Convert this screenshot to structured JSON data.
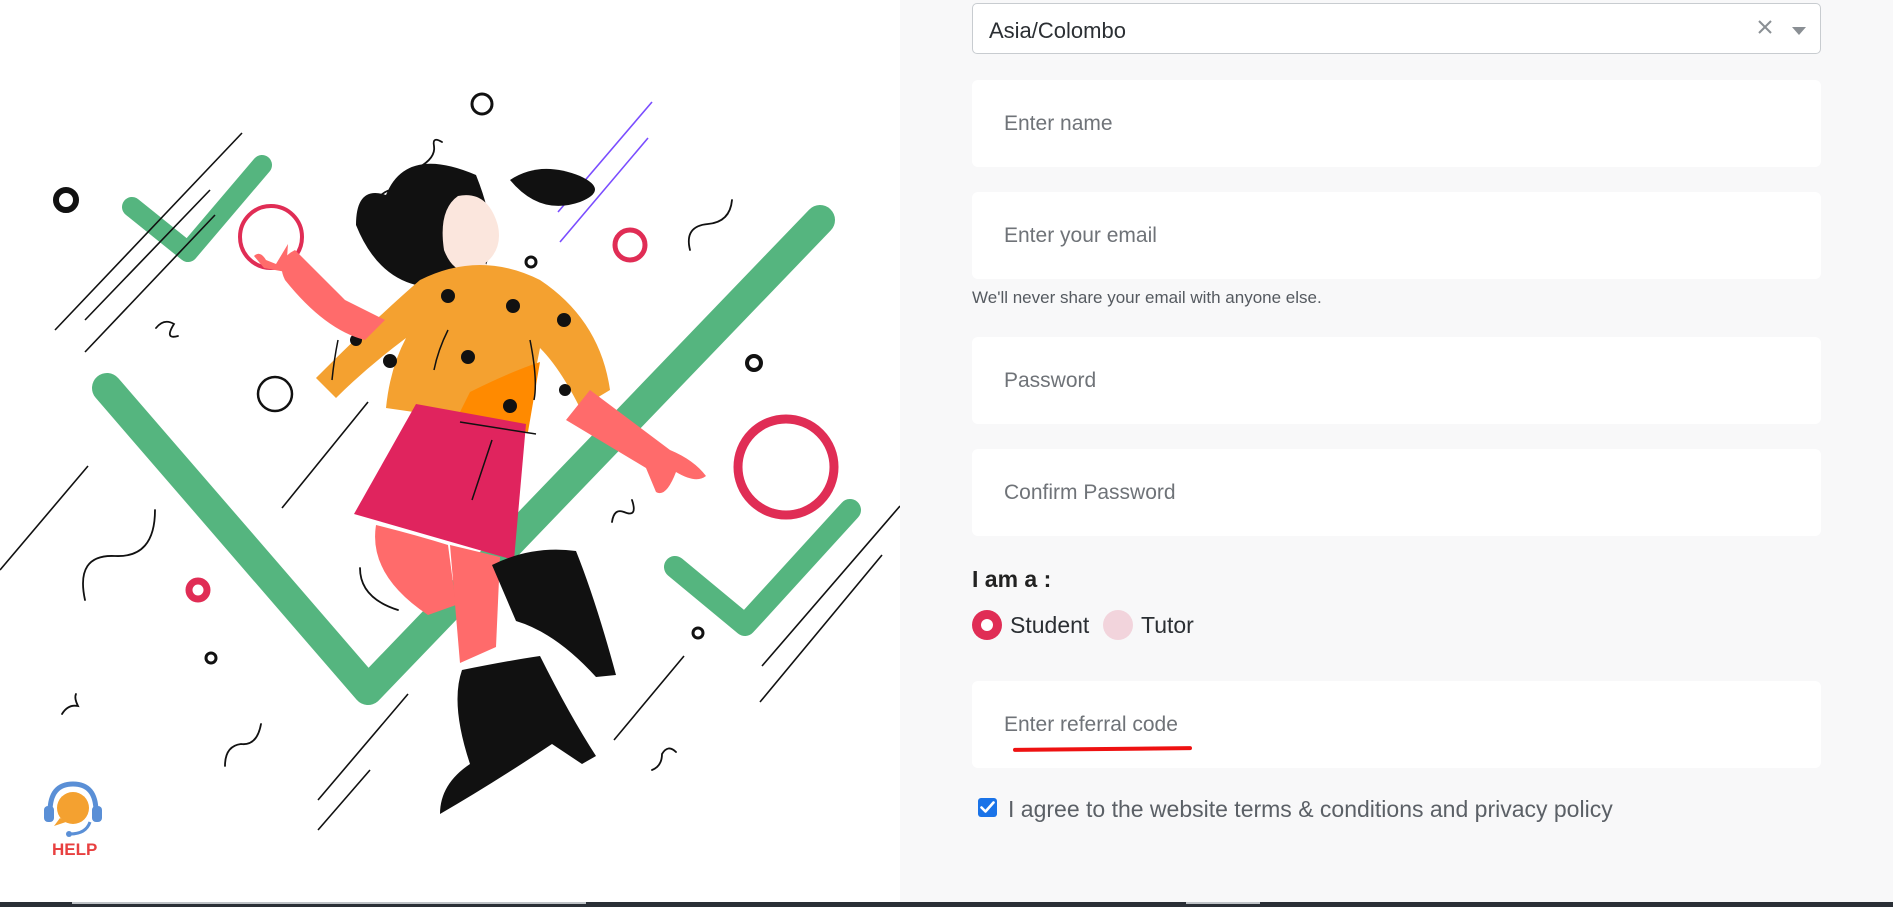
{
  "timezone_select": {
    "value": "Asia/Colombo",
    "clear_icon": "close-icon",
    "arrow_icon": "caret-down-icon"
  },
  "fields": {
    "name_placeholder": "Enter name",
    "email_placeholder": "Enter your email",
    "email_help": "We'll never share your email with anyone else.",
    "password_placeholder": "Password",
    "confirm_password_placeholder": "Confirm Password",
    "referral_placeholder": "Enter referral code"
  },
  "role": {
    "label": "I am a :",
    "options": [
      {
        "label": "Student",
        "selected": true
      },
      {
        "label": "Tutor",
        "selected": false
      }
    ]
  },
  "agreement": {
    "checked": true,
    "label": "I agree to the website terms & conditions and privacy policy"
  },
  "help_widget": {
    "label": "HELP",
    "icon": "headset-icon"
  },
  "colors": {
    "accent": "#e02d55",
    "green": "#55b57f",
    "orange": "#f4a130",
    "annotation_red": "#ee1111",
    "checkbox_blue": "#1a73e8"
  }
}
